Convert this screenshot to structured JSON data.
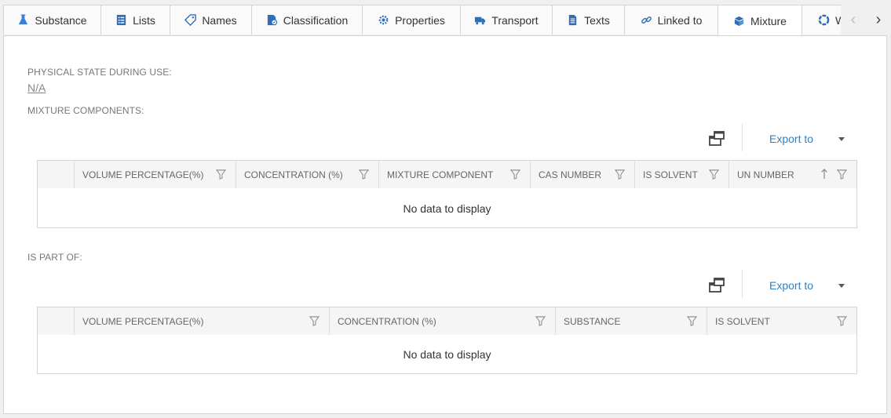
{
  "tabs": [
    {
      "label": "Substance",
      "icon": "flask-icon",
      "color": "#3a7fd5"
    },
    {
      "label": "Lists",
      "icon": "list-document-icon",
      "color": "#2f6db8"
    },
    {
      "label": "Names",
      "icon": "tag-icon",
      "color": "#2f6db8"
    },
    {
      "label": "Classification",
      "icon": "classification-icon",
      "color": "#2f6db8"
    },
    {
      "label": "Properties",
      "icon": "properties-gear-icon",
      "color": "#2f6db8"
    },
    {
      "label": "Transport",
      "icon": "truck-icon",
      "color": "#2f6db8"
    },
    {
      "label": "Texts",
      "icon": "text-document-icon",
      "color": "#2f6db8"
    },
    {
      "label": "Linked to",
      "icon": "link-icon",
      "color": "#2f6db8"
    },
    {
      "label": "Mixture",
      "icon": "mixture-cubes-icon",
      "color": "#2f6db8"
    },
    {
      "label": "W",
      "icon": "recycle-icon",
      "color": "#2f6db8"
    }
  ],
  "active_tab": "Mixture",
  "nav": {
    "prev": "‹",
    "next": "›"
  },
  "physical_state": {
    "label": "PHYSICAL STATE DURING USE:",
    "value": "N/A"
  },
  "mixture_components": {
    "label": "MIXTURE COMPONENTS:",
    "export_label": "Export to",
    "columns": [
      "VOLUME PERCENTAGE(%)",
      "CONCENTRATION (%)",
      "MIXTURE COMPONENT",
      "CAS NUMBER",
      "IS SOLVENT",
      "UN NUMBER"
    ],
    "empty_text": "No data to display"
  },
  "is_part_of": {
    "label": "IS PART OF:",
    "export_label": "Export to",
    "columns": [
      "VOLUME PERCENTAGE(%)",
      "CONCENTRATION (%)",
      "SUBSTANCE",
      "IS SOLVENT"
    ],
    "empty_text": "No data to display"
  },
  "colors": {
    "accent": "#2f7fc1",
    "border": "#d4d4d4",
    "header_bg": "#f5f5f5"
  }
}
